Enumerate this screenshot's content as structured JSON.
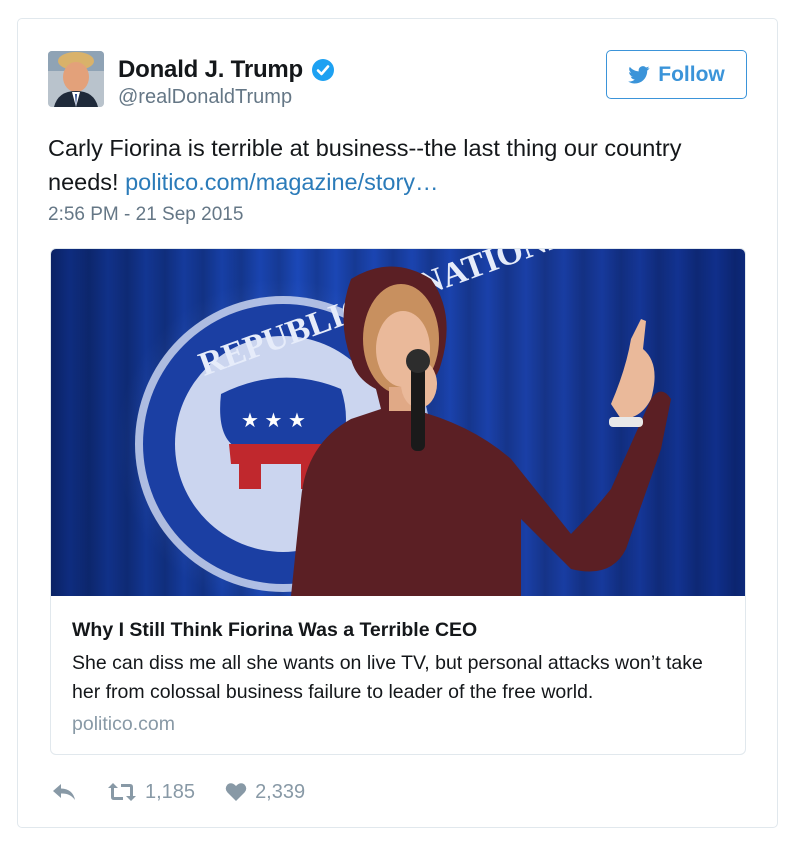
{
  "author": {
    "name": "Donald J. Trump",
    "handle": "@realDonaldTrump",
    "verified": true
  },
  "follow_button": {
    "label": "Follow",
    "icon": "twitter-bird-icon"
  },
  "tweet": {
    "text": "Carly Fiorina is terrible at business--the last thing our country needs! ",
    "link_text": "politico.com/magazine/story…",
    "timestamp": "2:56 PM - 21 Sep 2015"
  },
  "card": {
    "title": "Why I Still Think Fiorina Was a Terrible CEO",
    "description": "She can diss me all she wants on live TV, but personal attacks won’t take her from colossal business failure to leader of the free world.",
    "domain": "politico.com",
    "image_logo_text": "REPUBLICAN NATIONAL C"
  },
  "actions": {
    "reply_icon": "reply-icon",
    "retweet_icon": "retweet-icon",
    "retweet_count": "1,185",
    "like_icon": "heart-icon",
    "like_count": "2,339"
  },
  "colors": {
    "link": "#2b7bb9",
    "follow_blue": "#3b94d9",
    "muted": "#657786",
    "action_gray": "#8899a6",
    "border": "#e1e8ed"
  }
}
